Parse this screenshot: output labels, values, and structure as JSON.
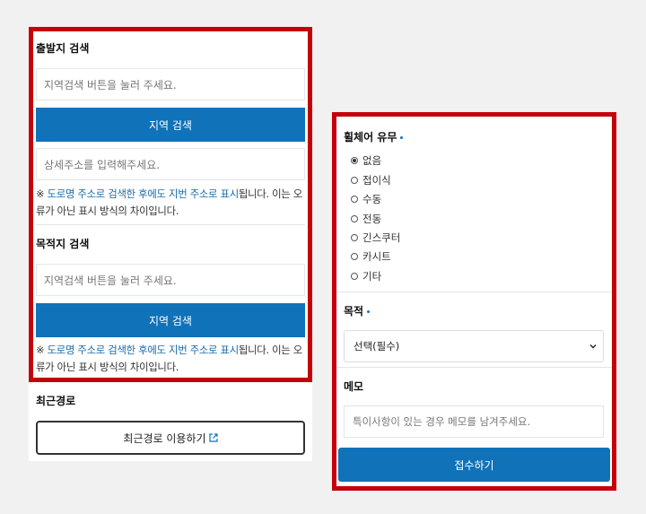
{
  "departure": {
    "title": "출발지 검색",
    "search_placeholder": "지역검색 버튼을 눌러 주세요.",
    "search_button": "지역 검색",
    "detail_placeholder": "상세주소를 입력해주세요.",
    "notice_prefix": "※ ",
    "notice_hl1": "도로명 주소로 검색한 후에도 지번 주소로 표시",
    "notice_line1_rest": "됩니다. 이는 오",
    "notice_line2": "류가 아닌 표시 방식의 차이입니다."
  },
  "destination": {
    "title": "목적지 검색",
    "search_placeholder": "지역검색 버튼을 눌러 주세요.",
    "search_button": "지역 검색",
    "notice_prefix": "※ ",
    "notice_hl1": "도로명 주소로 검색한 후에도 지번 주소로 표시",
    "notice_line1_rest": "됩니다. 이는 오",
    "notice_line2": "류가 아닌 표시 방식의 차이입니다."
  },
  "recent": {
    "title": "최근경로",
    "button": "최근경로 이용하기"
  },
  "wheelchair": {
    "title": "휠체어 유무",
    "options": [
      "없음",
      "접이식",
      "수동",
      "전동",
      "긴스쿠터",
      "카시트",
      "기타"
    ],
    "selected": "없음"
  },
  "purpose": {
    "title": "목적",
    "selected": "선택(필수)"
  },
  "memo": {
    "title": "메모",
    "placeholder": "특이사항이 있는 경우 메모를 남겨주세요."
  },
  "submit_label": "접수하기",
  "colors": {
    "accent": "#1072b8",
    "highlight_frame": "#c4000b"
  }
}
